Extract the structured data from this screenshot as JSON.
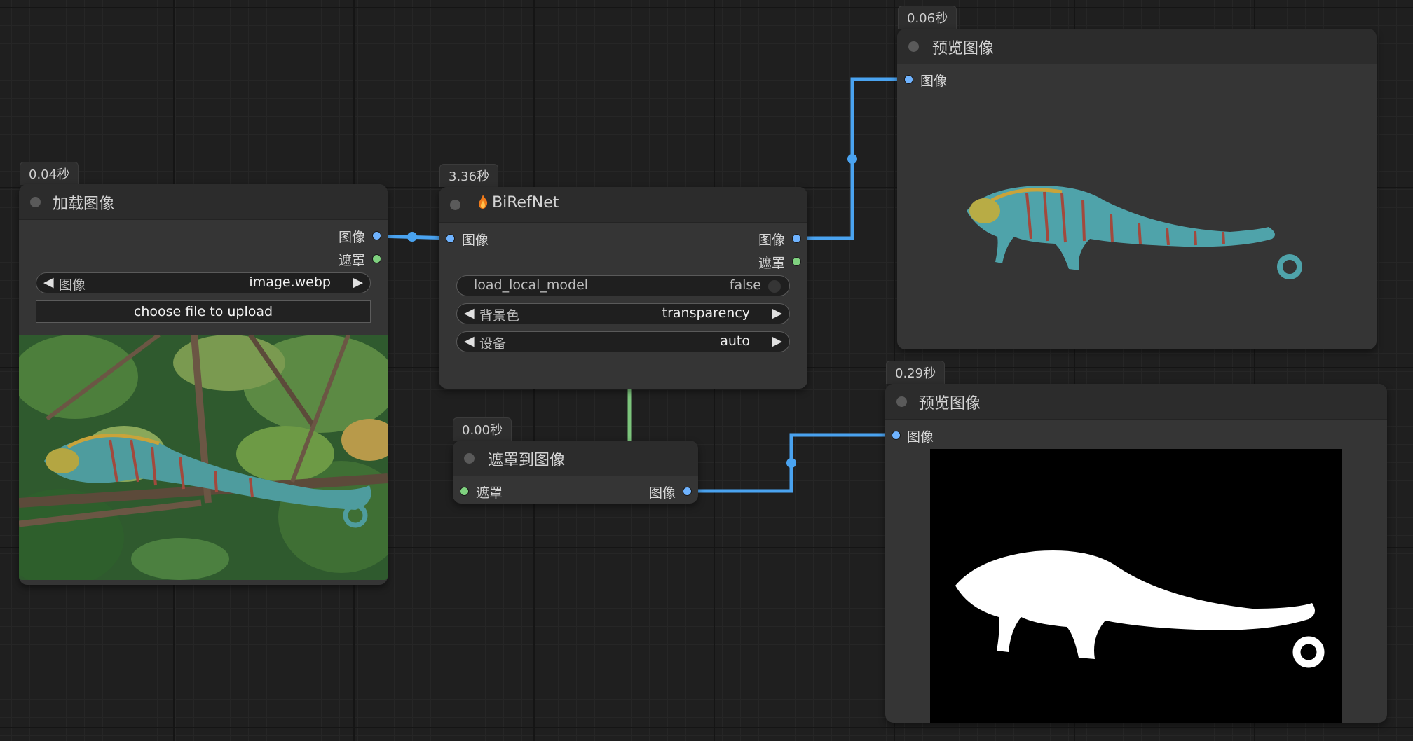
{
  "colors": {
    "image_wire": "#4aa3f0",
    "mask_wire": "#7cc57c",
    "node_bg": "#353535",
    "canvas_bg": "#1f1f1f"
  },
  "nodes": {
    "load_image": {
      "time": "0.04秒",
      "title": "加载图像",
      "outputs": {
        "image": "图像",
        "mask": "遮罩"
      },
      "widget_image": {
        "label": "图像",
        "value": "image.webp"
      },
      "upload_label": "choose file to upload"
    },
    "birefnet": {
      "time": "3.36秒",
      "title": "BiRefNet",
      "icon": "fire-icon",
      "input_image": "图像",
      "outputs": {
        "image": "图像",
        "mask": "遮罩"
      },
      "load_local_model": {
        "label": "load_local_model",
        "value": "false"
      },
      "background": {
        "label": "背景色",
        "value": "transparency"
      },
      "device": {
        "label": "设备",
        "value": "auto"
      }
    },
    "mask_to_image": {
      "time": "0.00秒",
      "title": "遮罩到图像",
      "input_mask": "遮罩",
      "output_image": "图像"
    },
    "preview_1": {
      "time": "0.06秒",
      "title": "预览图像",
      "input_image": "图像"
    },
    "preview_2": {
      "time": "0.29秒",
      "title": "预览图像",
      "input_image": "图像"
    }
  }
}
